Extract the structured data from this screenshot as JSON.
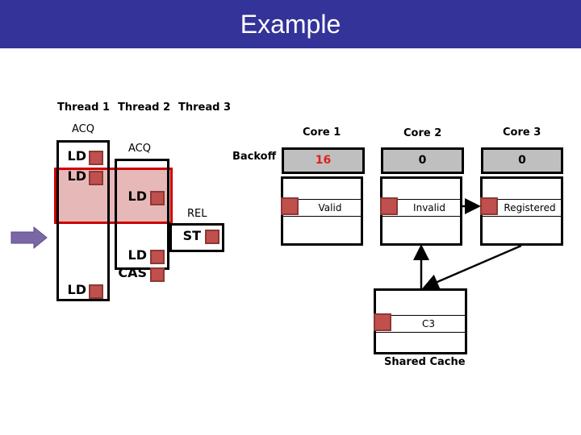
{
  "header": {
    "title": "Example",
    "background": "#333399"
  },
  "threads": {
    "labels": [
      "Thread 1",
      "Thread 2",
      "Thread 3"
    ],
    "thread1": {
      "acq_label": "ACQ",
      "instructions": [
        "LD",
        "LD",
        "LD"
      ]
    },
    "thread2": {
      "acq_label": "ACQ",
      "instructions": [
        "LD",
        "LD",
        "CAS"
      ]
    },
    "thread3": {
      "rel_label": "REL",
      "instructions": [
        "ST"
      ]
    }
  },
  "backoff_label": "Backoff",
  "cores": [
    {
      "label": "Core 1",
      "backoff": "16",
      "backoff_color": "#e0201c",
      "line_state": "Valid"
    },
    {
      "label": "Core 2",
      "backoff": "0",
      "backoff_color": "#000000",
      "line_state": "Invalid"
    },
    {
      "label": "Core 3",
      "backoff": "0",
      "backoff_color": "#000000",
      "line_state": "Registered"
    }
  ],
  "shared_cache": {
    "label": "Shared Cache",
    "line_value": "C3"
  },
  "colors": {
    "highlight_fill": "#e6b9b8",
    "highlight_border": "#cc0000",
    "square": "#c0504d",
    "arrow": "#7a68a6"
  }
}
